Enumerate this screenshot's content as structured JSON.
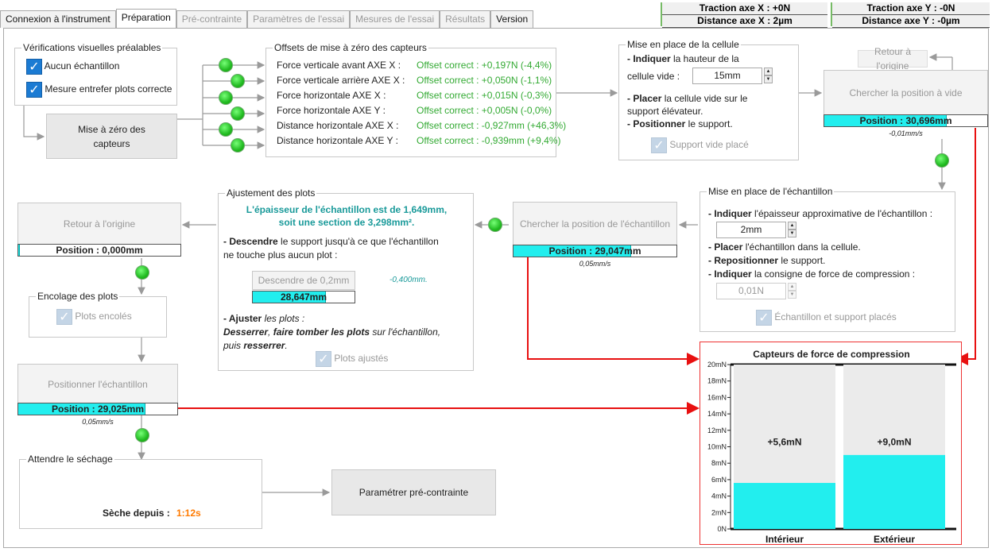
{
  "tabs": [
    "Connexion à l'instrument",
    "Préparation",
    "Pré-contrainte",
    "Paramètres de l'essai",
    "Mesures de l'essai",
    "Résultats",
    "Version"
  ],
  "status": {
    "traction_x": "Traction axe X : +0N",
    "distance_x": "Distance axe X : 2µm",
    "traction_y": "Traction axe Y : -0N",
    "distance_y": "Distance axe Y : -0µm"
  },
  "visual": {
    "title": "Vérifications visuelles préalables",
    "cb1": "Aucun échantillon",
    "cb2": "Mesure entrefer plots correcte"
  },
  "zero_btn": "Mise à zéro des capteurs",
  "offsets": {
    "title": "Offsets de mise à zéro des capteurs",
    "rows": [
      {
        "label": "Force verticale avant AXE X :",
        "value": "Offset correct : +0,197N (-4,4%)"
      },
      {
        "label": "Force verticale arrière AXE X :",
        "value": "Offset correct : +0,050N (-1,1%)"
      },
      {
        "label": "Force horizontale AXE X :",
        "value": "Offset correct : +0,015N (-0,3%)"
      },
      {
        "label": "Force horizontale AXE Y :",
        "value": "Offset correct : +0,005N (-0,0%)"
      },
      {
        "label": "Distance horizontale AXE X :",
        "value": "Offset correct : -0,927mm (+46,3%)"
      },
      {
        "label": "Distance horizontale AXE Y :",
        "value": "Offset correct : -0,939mm (+9,4%)"
      }
    ]
  },
  "cellule": {
    "title": "Mise en place de la cellule",
    "l1a": "- Indiquer",
    "l1b": " la hauteur de la",
    "l2": "cellule vide :",
    "height": "15mm",
    "l3a": "- Placer",
    "l3b": " la cellule vide sur le",
    "l4": "support élévateur.",
    "l5a": "- Positionner",
    "l5b": " le support.",
    "cb": "Support vide placé"
  },
  "retour_top": "Retour à l'origine",
  "chercher_vide": {
    "label": "Chercher la position à vide",
    "position": "Position : 30,696mm",
    "fill": 0.75,
    "speed": "-0,01mm/s"
  },
  "echantillon": {
    "title": "Mise en place de l'échantillon",
    "l1a": "- Indiquer",
    "l1b": " l'épaisseur approximative de l'échantillon :",
    "thickness": "2mm",
    "l2a": "- Placer",
    "l2b": " l'échantillon dans la cellule.",
    "l3a": "- Repositionner",
    "l3b": " le support.",
    "l4a": "- Indiquer",
    "l4b": " la consigne de force de compression :",
    "force": "0,01N",
    "cb": "Échantillon et support placés"
  },
  "chercher_ech": {
    "label": "Chercher la position de l'échantillon",
    "position": "Position : 29,047mm",
    "fill": 0.72,
    "speed": "0,05mm/s"
  },
  "ajustement": {
    "title": "Ajustement des plots",
    "info1": "L'épaisseur de l'échantillon est de 1,649mm,",
    "info2": "soit une section de 3,298mm².",
    "l1a": "- Descendre",
    "l1b": " le support jusqu'à ce que l'échantillon",
    "l2": "ne touche plus aucun plot :",
    "btn": "Descendre de 0,2mm",
    "offset": "-0,400mm.",
    "position": "28,647mm",
    "fill": 0.72,
    "l3a": "- Ajuster",
    "l3b": " les plots :",
    "l4a": "Desserrer",
    "l4b": ", ",
    "l4c": "faire tomber les plots",
    "l4d": " sur l'échantillon,",
    "l5a": "puis ",
    "l5b": "resserrer",
    "l5c": ".",
    "cb": "Plots ajustés"
  },
  "retour_left": {
    "label": "Retour à l'origine",
    "position": "Position : 0,000mm",
    "fill": 0.01
  },
  "encolage": {
    "title": "Encolage des plots",
    "cb": "Plots encolés"
  },
  "positionner": {
    "label": "Positionner l'échantillon",
    "position": "Position : 29,025mm",
    "fill": 0.8,
    "speed": "0,05mm/s"
  },
  "sechage": {
    "title": "Attendre le séchage",
    "label": "Sèche depuis :",
    "time": "1:12s"
  },
  "param_btn": "Paramétrer pré-contrainte",
  "chart_data": {
    "type": "bar",
    "title": "Capteurs de force de compression",
    "categories": [
      "Intérieur",
      "Extérieur"
    ],
    "values": [
      5.6,
      9.0
    ],
    "value_labels": [
      "+5,6mN",
      "+9,0mN"
    ],
    "ylim": [
      0,
      20
    ],
    "yticks": [
      "0N",
      "2mN",
      "4mN",
      "6mN",
      "8mN",
      "10mN",
      "12mN",
      "14mN",
      "16mN",
      "18mN",
      "20mN"
    ],
    "bar_color": "#22eeee"
  },
  "colors": {
    "accent": "#1b7bd3",
    "ok": "#33cc33",
    "arrow": "#e81010",
    "orange": "#ff7a00",
    "teal": "#1a9a9a"
  }
}
